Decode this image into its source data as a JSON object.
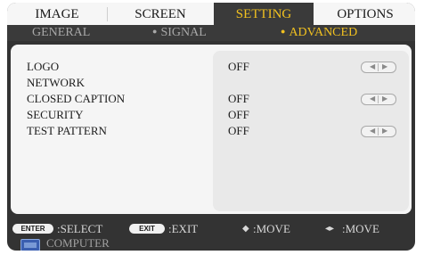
{
  "tabs": [
    {
      "label": "IMAGE",
      "active": false
    },
    {
      "label": "SCREEN",
      "active": false
    },
    {
      "label": "SETTING",
      "active": true
    },
    {
      "label": "OPTIONS",
      "active": false
    }
  ],
  "subtabs": [
    {
      "label": "GENERAL",
      "active": false
    },
    {
      "label": "SIGNAL",
      "active": false
    },
    {
      "label": "ADVANCED",
      "active": true
    }
  ],
  "rows": [
    {
      "label": "LOGO",
      "value": "OFF",
      "has_arrows": true
    },
    {
      "label": "NETWORK",
      "value": "",
      "has_arrows": false
    },
    {
      "label": "CLOSED CAPTION",
      "value": "OFF",
      "has_arrows": true
    },
    {
      "label": "SECURITY",
      "value": "OFF",
      "has_arrows": false
    },
    {
      "label": "TEST PATTERN",
      "value": "OFF",
      "has_arrows": true
    }
  ],
  "footer": {
    "enter_badge": "ENTER",
    "enter_label": ":SELECT",
    "exit_badge": "EXIT",
    "exit_label": ":EXIT",
    "move_vertical_label": ":MOVE",
    "move_horizontal_label": ":MOVE"
  },
  "source": {
    "label": "COMPUTER",
    "icon": "computer-icon"
  },
  "colors": {
    "accent": "#f0c020",
    "background": "#333333",
    "panel": "#f5f5f5"
  }
}
